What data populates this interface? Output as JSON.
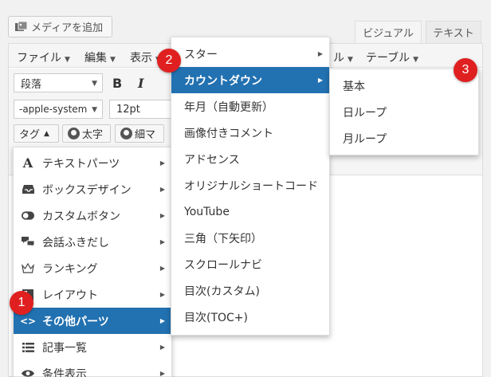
{
  "media_button": {
    "label": "メディアを追加"
  },
  "tabs": {
    "visual": "ビジュアル",
    "text": "テキスト"
  },
  "menubar": [
    {
      "label": "ファイル"
    },
    {
      "label": "編集"
    },
    {
      "label": "表示"
    },
    {
      "label": "ル"
    },
    {
      "label": "テーブル"
    }
  ],
  "toolbar": {
    "format_select": "段落",
    "bold": "B",
    "italic": "I",
    "font_select": "-apple-system",
    "size_select": "12pt"
  },
  "quicktags": {
    "tag": "タグ",
    "bold": "太字",
    "thin": "細マ"
  },
  "menu_main": [
    {
      "label": "テキストパーツ",
      "icon": "text-icon"
    },
    {
      "label": "ボックスデザイン",
      "icon": "inbox-icon"
    },
    {
      "label": "カスタムボタン",
      "icon": "toggle-icon"
    },
    {
      "label": "会話ふきだし",
      "icon": "chat-bubble-icon"
    },
    {
      "label": "ランキング",
      "icon": "crown-icon"
    },
    {
      "label": "レイアウト",
      "icon": "layout-icon"
    },
    {
      "label": "その他パーツ",
      "icon": "code-icon"
    },
    {
      "label": "記事一覧",
      "icon": "list-icon"
    },
    {
      "label": "条件表示",
      "icon": "eye-icon"
    }
  ],
  "menu_other": [
    {
      "label": "スター"
    },
    {
      "label": "カウントダウン"
    },
    {
      "label": "年月（自動更新）"
    },
    {
      "label": "画像付きコメント"
    },
    {
      "label": "アドセンス"
    },
    {
      "label": "オリジナルショートコード"
    },
    {
      "label": "YouTube"
    },
    {
      "label": "三角（下矢印）"
    },
    {
      "label": "スクロールナビ"
    },
    {
      "label": "目次(カスタム)"
    },
    {
      "label": "目次(TOC+)"
    }
  ],
  "menu_countdown": [
    {
      "label": "基本"
    },
    {
      "label": "日ループ"
    },
    {
      "label": "月ループ"
    }
  ],
  "badges": [
    "1",
    "2",
    "3"
  ],
  "colors": {
    "highlight": "#2271b1",
    "badge": "#e02020"
  }
}
